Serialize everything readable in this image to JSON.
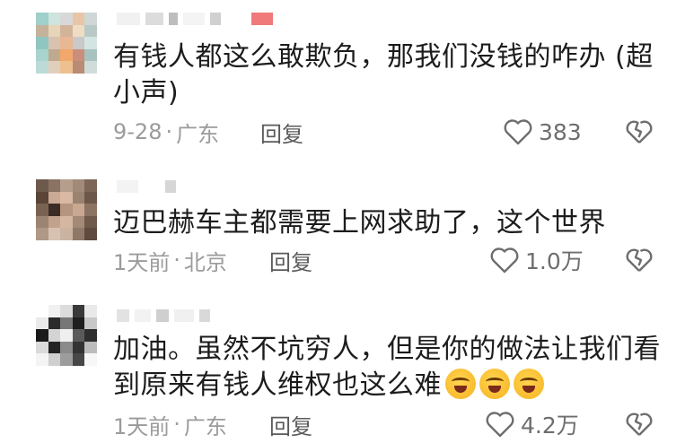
{
  "comments": [
    {
      "text": "有钱人都这么敢欺负，那我们没钱的咋办 (超小声)",
      "time": "9-28",
      "location": "广东",
      "reply_label": "回复",
      "likes": "383",
      "avatar_icon": "pixelated-avatar",
      "like_icon": "heart-outline-icon",
      "dislike_icon": "broken-heart-icon"
    },
    {
      "text": "迈巴赫车主都需要上网求助了，这个世界",
      "time": "1天前",
      "location": "北京",
      "reply_label": "回复",
      "likes": "1.0万",
      "avatar_icon": "pixelated-avatar",
      "like_icon": "heart-outline-icon",
      "dislike_icon": "broken-heart-icon"
    },
    {
      "text": "加油。虽然不坑穷人，但是你的做法让我们看到原来有钱人维权也这么难",
      "emojis": [
        "crying-laughing-emoji",
        "crying-laughing-emoji",
        "crying-laughing-emoji"
      ],
      "time": "1天前",
      "location": "广东",
      "reply_label": "回复",
      "likes": "4.2万",
      "avatar_icon": "pixelated-avatar",
      "like_icon": "heart-outline-icon",
      "dislike_icon": "broken-heart-icon"
    }
  ],
  "meta_separator": "·",
  "colors": {
    "text": "#1c1c1c",
    "meta": "#9b9b9b",
    "reply": "#5a5a5a",
    "icon": "#6e6e6e",
    "background": "#ffffff"
  }
}
